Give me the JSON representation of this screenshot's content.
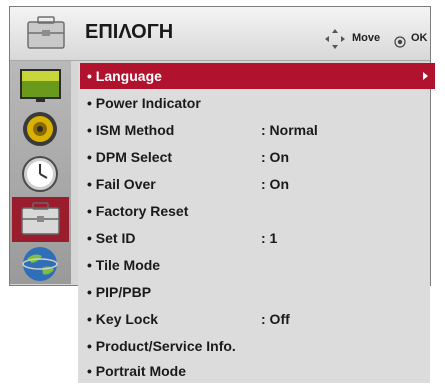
{
  "header": {
    "title": "ΕΠΙΛΟΓΗ",
    "hint_move_label": "Move",
    "hint_ok_label": "OK",
    "icon": "toolbox-icon"
  },
  "tabs": [
    {
      "name": "picture-tab",
      "icon": "picture-icon",
      "selected": false
    },
    {
      "name": "sound-tab",
      "icon": "speaker-icon",
      "selected": false
    },
    {
      "name": "time-tab",
      "icon": "clock-icon",
      "selected": false
    },
    {
      "name": "option-tab",
      "icon": "toolbox-icon",
      "selected": true
    },
    {
      "name": "network-tab",
      "icon": "globe-icon",
      "selected": false
    }
  ],
  "menu": {
    "items": [
      {
        "label": "• Language",
        "value": "",
        "selected": true,
        "has_arrow": true
      },
      {
        "label": "• Power Indicator",
        "value": ""
      },
      {
        "label": "• ISM Method",
        "value": ": Normal"
      },
      {
        "label": "• DPM Select",
        "value": ": On"
      },
      {
        "label": "• Fail Over",
        "value": ": On"
      },
      {
        "label": "• Factory Reset",
        "value": ""
      },
      {
        "label": "• Set ID",
        "value": ": 1"
      },
      {
        "label": "• Tile Mode",
        "value": ""
      },
      {
        "label": "• PIP/PBP",
        "value": ""
      },
      {
        "label": "• Key Lock",
        "value": ": Off"
      },
      {
        "label": "• Product/Service Info.",
        "value": ""
      },
      {
        "label": "• Portrait Mode",
        "value": ""
      }
    ]
  },
  "colors": {
    "selected_item_bg": "#b1122e",
    "selected_tab_bg": "#9a1d2e",
    "panel_bg": "#dcdcdc"
  }
}
